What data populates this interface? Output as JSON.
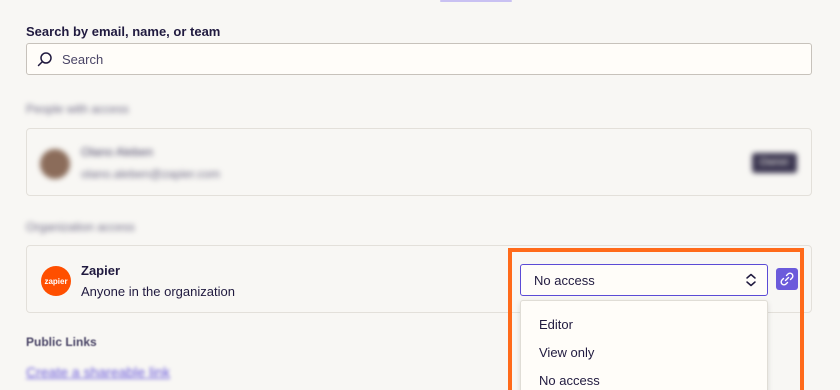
{
  "search": {
    "label": "Search by email, name, or team",
    "placeholder": "Search",
    "value": ""
  },
  "people_access": {
    "section_label": "People with access",
    "person": {
      "name": "Olano Aleben",
      "email": "olano.aleben@zapier.com",
      "role_badge": "Owner"
    }
  },
  "org_access": {
    "section_label": "Organization access",
    "org_name": "Zapier",
    "org_description": "Anyone in the organization",
    "logo_text": "zapier",
    "selected_access": "No access",
    "options": [
      "Editor",
      "View only",
      "No access"
    ]
  },
  "public_links": {
    "section_label": "Public Links",
    "link_text": "Create a shareable link"
  },
  "colors": {
    "accent": "#6b5bdb",
    "zapier_orange": "#ff4f00",
    "highlight": "#ff6a1a",
    "background": "#f8f7f4"
  },
  "icons": {
    "search": "search-icon",
    "chevron": "chevron-updown-icon",
    "link": "link-icon"
  }
}
